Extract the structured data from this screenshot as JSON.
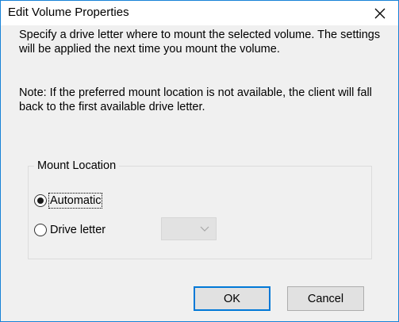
{
  "dialog": {
    "title": "Edit Volume Properties",
    "description": "Specify a drive letter where to mount the selected volume. The settings will be applied the next time you mount the volume.",
    "note": "Note: If the preferred mount location is not available, the client will fall back to the first available drive letter."
  },
  "mount_location": {
    "label": "Mount Location",
    "options": [
      {
        "label": "Automatic",
        "checked": true
      },
      {
        "label": "Drive letter",
        "checked": false
      }
    ],
    "drive_letter_value": ""
  },
  "buttons": {
    "ok_label": "OK",
    "cancel_label": "Cancel"
  },
  "icons": {
    "close": "close-icon",
    "dropdown": "chevron-down-icon"
  },
  "colors": {
    "window_border": "#1883d7",
    "dialog_background": "#f0f0f0",
    "default_button_border": "#0078d7"
  }
}
